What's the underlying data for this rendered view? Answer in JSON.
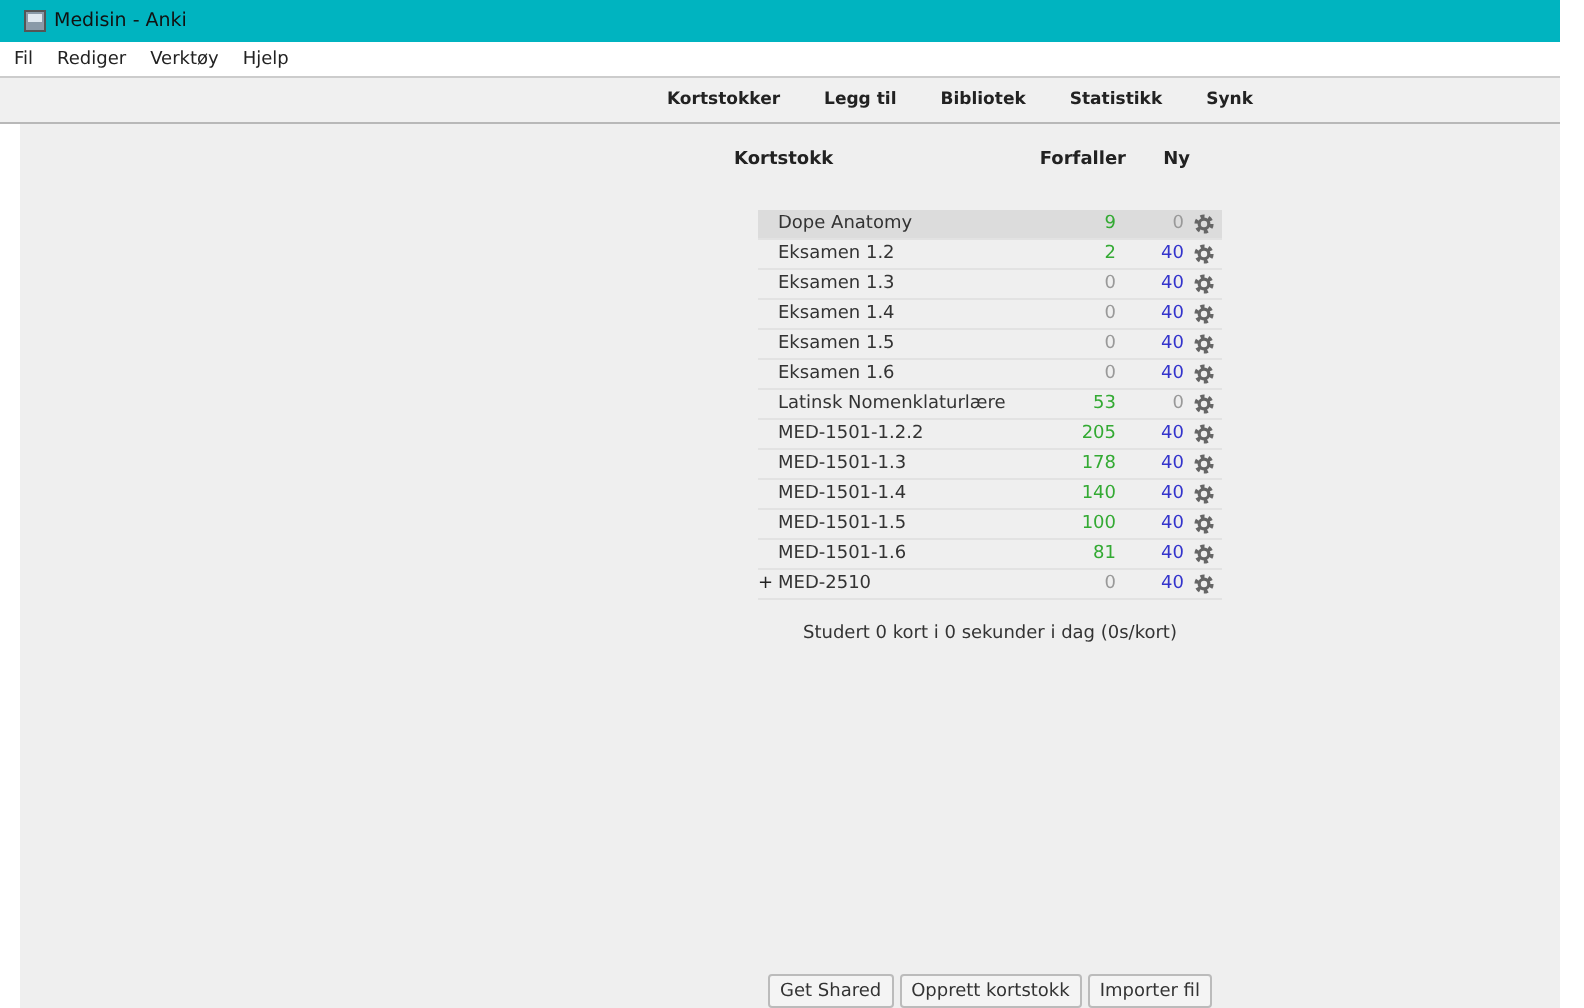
{
  "window": {
    "title": "Medisin - Anki"
  },
  "menu": [
    "Fil",
    "Rediger",
    "Verktøy",
    "Hjelp"
  ],
  "toolbar": [
    "Kortstokker",
    "Legg til",
    "Bibliotek",
    "Statistikk",
    "Synk"
  ],
  "table": {
    "columns": [
      "Kortstokk",
      "Forfaller",
      "Ny"
    ],
    "rows": [
      {
        "name": "Dope Anatomy",
        "current": true,
        "due": {
          "text": "9",
          "muted": false
        },
        "new": {
          "text": "0",
          "muted": true
        }
      },
      {
        "name": "Eksamen 1.2",
        "current": false,
        "due": {
          "text": "2",
          "muted": false
        },
        "new": {
          "text": "40",
          "muted": false
        }
      },
      {
        "name": "Eksamen 1.3",
        "current": false,
        "due": {
          "text": "0",
          "muted": true
        },
        "new": {
          "text": "40",
          "muted": false
        }
      },
      {
        "name": "Eksamen 1.4",
        "current": false,
        "due": {
          "text": "0",
          "muted": true
        },
        "new": {
          "text": "40",
          "muted": false
        }
      },
      {
        "name": "Eksamen 1.5",
        "current": false,
        "due": {
          "text": "0",
          "muted": true
        },
        "new": {
          "text": "40",
          "muted": false
        }
      },
      {
        "name": "Eksamen 1.6",
        "current": false,
        "due": {
          "text": "0",
          "muted": true
        },
        "new": {
          "text": "40",
          "muted": false
        }
      },
      {
        "name": "Latinsk Nomenklaturlære",
        "current": false,
        "due": {
          "text": "53",
          "muted": false
        },
        "new": {
          "text": "0",
          "muted": true
        }
      },
      {
        "name": "MED-1501-1.2.2",
        "current": false,
        "due": {
          "text": "205",
          "muted": false
        },
        "new": {
          "text": "40",
          "muted": false
        }
      },
      {
        "name": "MED-1501-1.3",
        "current": false,
        "due": {
          "text": "178",
          "muted": false
        },
        "new": {
          "text": "40",
          "muted": false
        }
      },
      {
        "name": "MED-1501-1.4",
        "current": false,
        "due": {
          "text": "140",
          "muted": false
        },
        "new": {
          "text": "40",
          "muted": false
        }
      },
      {
        "name": "MED-1501-1.5",
        "current": false,
        "due": {
          "text": "100",
          "muted": false
        },
        "new": {
          "text": "40",
          "muted": false
        }
      },
      {
        "name": "MED-1501-1.6",
        "current": false,
        "due": {
          "text": "81",
          "muted": false
        },
        "new": {
          "text": "40",
          "muted": false
        }
      },
      {
        "name": "MED-2510",
        "expander": "+",
        "current": false,
        "due": {
          "text": "0",
          "muted": true
        },
        "new": {
          "text": "40",
          "muted": false
        }
      }
    ]
  },
  "studied": "Studert 0 kort i 0 sekunder i dag (0s/kort)",
  "buttons": [
    "Get Shared",
    "Opprett kortstokk",
    "Importer fil"
  ]
}
